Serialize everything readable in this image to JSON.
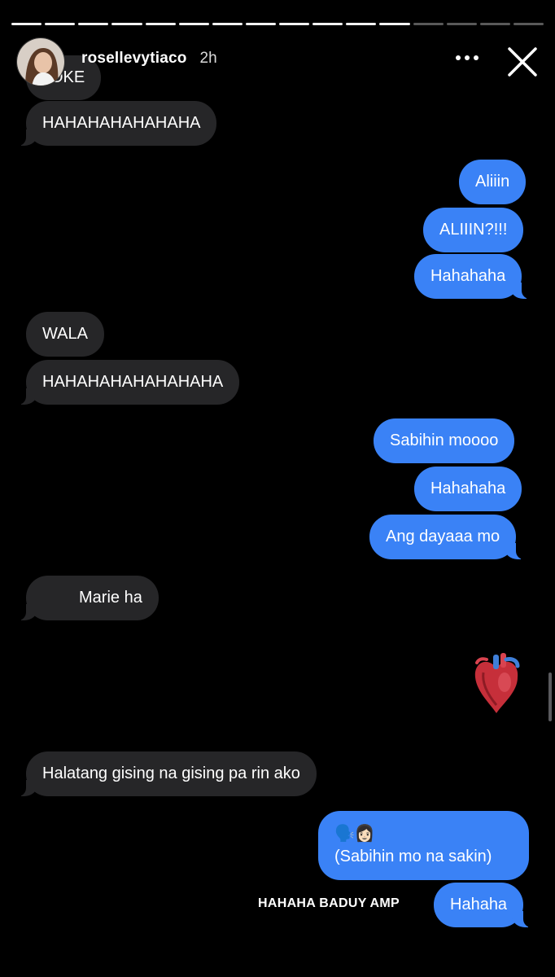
{
  "story": {
    "segments": 16,
    "segments_done": 12
  },
  "header": {
    "username": "rosellevytiaco",
    "time": "2h",
    "more_icon": "more-horizontal-icon",
    "close_icon": "close-icon"
  },
  "messages": {
    "m0": "JOKE",
    "m1": "HAHAHAHAHAHAHA",
    "m2": "Aliiin",
    "m3": "ALIIIN?!!!",
    "m4": "Hahahaha",
    "m5": "WALA",
    "m6": "HAHAHAHAHAHAHAHA",
    "m7": "Sabihin moooo",
    "m8": "Hahahaha",
    "m9": "Ang dayaaa mo",
    "m10": "Marie ha",
    "m11": "❤️",
    "m12": "Halatang gising na gising pa rin ako",
    "m13_emoji": "🗣️👩🏻",
    "m13_text": "(Sabihin mo na sakin)",
    "m14": "Hahaha"
  },
  "caption": "HAHAHA BADUY AMP",
  "colors": {
    "incoming_bubble": "#262628",
    "outgoing_bubble": "#3a82f6",
    "background": "#000000"
  }
}
